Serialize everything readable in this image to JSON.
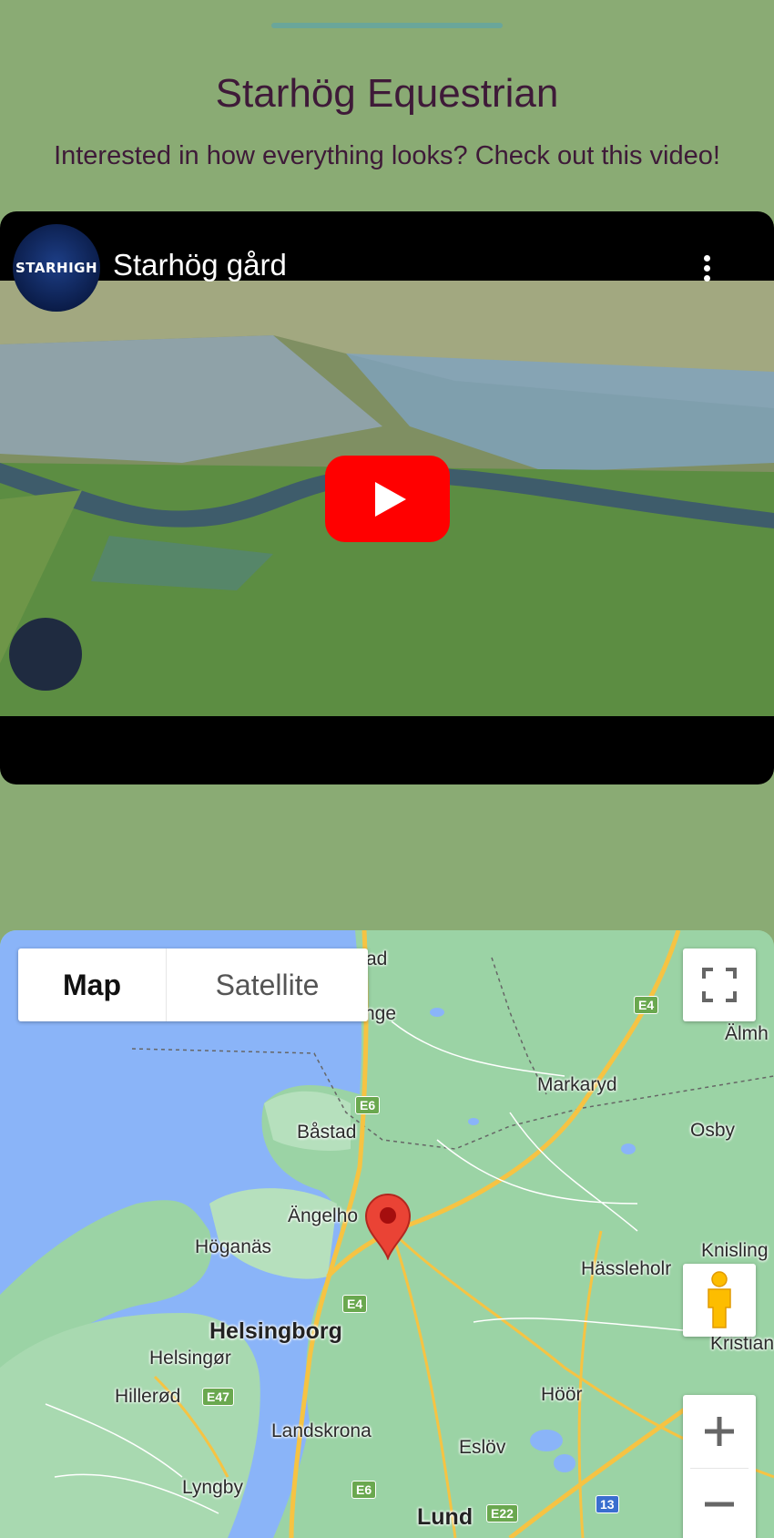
{
  "header": {
    "title": "Starhög Equestrian",
    "subtitle": "Interested in how everything looks? Check out this video!"
  },
  "video": {
    "channel_badge": "STARHIGH",
    "title": "Starhög gård",
    "menu_icon": "more-vert-icon",
    "play_icon": "play-icon"
  },
  "map": {
    "map_type": {
      "map_label": "Map",
      "satellite_label": "Satellite",
      "selected": "Map"
    },
    "controls": {
      "fullscreen_icon": "fullscreen-icon",
      "pegman_icon": "pegman-icon",
      "zoom_in_icon": "zoom-in-icon",
      "zoom_out_icon": "zoom-out-icon"
    },
    "places": [
      {
        "name": "ad"
      },
      {
        "name": "nge"
      },
      {
        "name": "Markaryd"
      },
      {
        "name": "Älmh"
      },
      {
        "name": "Båstad"
      },
      {
        "name": "Osby"
      },
      {
        "name": "Ängelho"
      },
      {
        "name": "Höganäs"
      },
      {
        "name": "Knisling"
      },
      {
        "name": "Hässleholr"
      },
      {
        "name": "Helsingborg"
      },
      {
        "name": "Helsingør"
      },
      {
        "name": "Kristian"
      },
      {
        "name": "Hillerød"
      },
      {
        "name": "Höör"
      },
      {
        "name": "Landskrona"
      },
      {
        "name": "Eslöv"
      },
      {
        "name": "Lyngby"
      },
      {
        "name": "Lund"
      }
    ],
    "roads": [
      {
        "label": "E4"
      },
      {
        "label": "E6"
      },
      {
        "label": "E4"
      },
      {
        "label": "E47"
      },
      {
        "label": "E6"
      },
      {
        "label": "E22"
      },
      {
        "label": "13"
      }
    ],
    "colors": {
      "land": "#9bd3a5",
      "water": "#8ab4f8",
      "road": "#f6c343",
      "marker": "#ea4335"
    }
  }
}
